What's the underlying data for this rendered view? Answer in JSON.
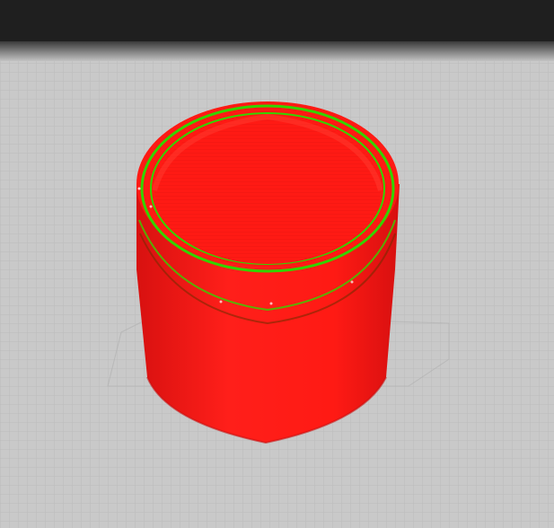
{
  "app": {
    "view": "layer-preview",
    "icons": {
      "model": "cup-model-icon"
    }
  },
  "colors": {
    "toolbar_bg": "#1f1f1f",
    "bed": "#c9c9c9",
    "grid": "#b7b7b7",
    "perimeter": "#ff1a14",
    "inner_wall": "#33d400"
  }
}
